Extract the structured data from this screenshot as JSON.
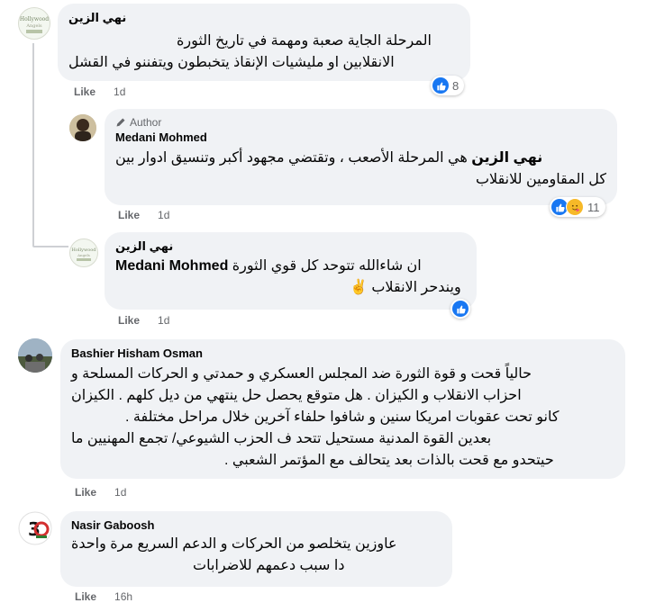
{
  "colors": {
    "bubble": "#f0f2f5",
    "accent": "#1877f2",
    "meta": "#65676b"
  },
  "comments": [
    {
      "name": "نهي الزين",
      "lines": [
        "المرحلة الجاية صعبة ومهمة في تاريخ الثورة",
        "الانقلابين او مليشيات الإنقاذ يتخبطون ويتفننو في القشل"
      ],
      "like": "Like",
      "time": "1d",
      "reactions": "8"
    },
    {
      "name": "Medani Mohmed",
      "badge": "Author",
      "mention": "نهي الزين",
      "lines": [
        "هي المرحلة الأصعب ، وتقتضي مجهود أكبر وتنسيق ادوار بين",
        "كل المقاومين للانقلاب"
      ],
      "like": "Like",
      "time": "1d",
      "reactions": "11"
    },
    {
      "name": "نهي الزين",
      "mention": "Medani Mohmed",
      "lines": [
        "ان شاءالله تتوحد كل قوي الثورة",
        "ويندحر الانقلاب ✌️"
      ],
      "like": "Like",
      "time": "1d"
    },
    {
      "name": "Bashier Hisham Osman",
      "lines": [
        "حالياً قحت و قوة الثورة ضد المجلس العسكري و حمدتي و الحركات المسلحة و",
        "احزاب الانقلاب و الكيزان . هل متوقع يحصل حل ينتهي من ديل كلهم . الكيزان",
        "كانو تحت عقوبات امريكا سنين و شافوا حلفاء آخرين خلال مراحل مختلفة .",
        "بعدين القوة المدنية مستحيل تتحد ف الحزب الشيوعي/ تجمع المهنيين ما",
        "حيتحدو مع قحت بالذات بعد يتحالف مع المؤتمر الشعبي ."
      ],
      "like": "Like",
      "time": "1d"
    },
    {
      "name": "Nasir Gaboosh",
      "lines": [
        "عاوزين يتخلصو من الحركات و الدعم السريع مرة واحدة",
        "دا سبب دعمهم للاضرابات"
      ],
      "like": "Like",
      "time": "16h"
    }
  ]
}
